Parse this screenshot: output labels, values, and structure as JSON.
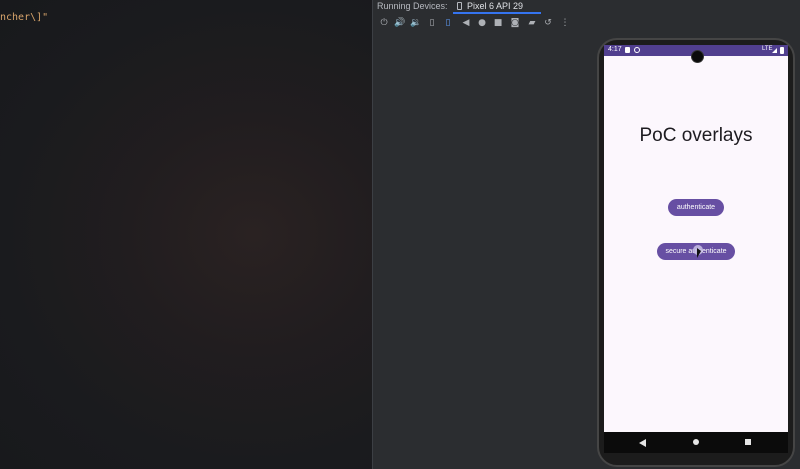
{
  "editor": {
    "code_fragment": "ncher\\]\""
  },
  "running_devices": {
    "title": "Running Devices:",
    "active_tab": "Pixel 6 API 29",
    "close_symbol": "⋮",
    "toolbar_icons": [
      "power-icon",
      "volume-up-icon",
      "volume-down-icon",
      "rotate-left-icon",
      "rotate-right-icon",
      "back-icon",
      "home-icon",
      "overview-icon",
      "screenshot-icon",
      "record-icon",
      "reset-icon",
      "more-icon"
    ]
  },
  "phone": {
    "status_time": "4:17",
    "network": "LTE",
    "app_title": "PoC overlays",
    "buttons": {
      "authenticate": "authenticate",
      "secure_authenticate": "secure authenticate"
    },
    "colors": {
      "status_bar": "#513f8f",
      "button": "#674fa3",
      "background": "#fcf7fd"
    }
  }
}
